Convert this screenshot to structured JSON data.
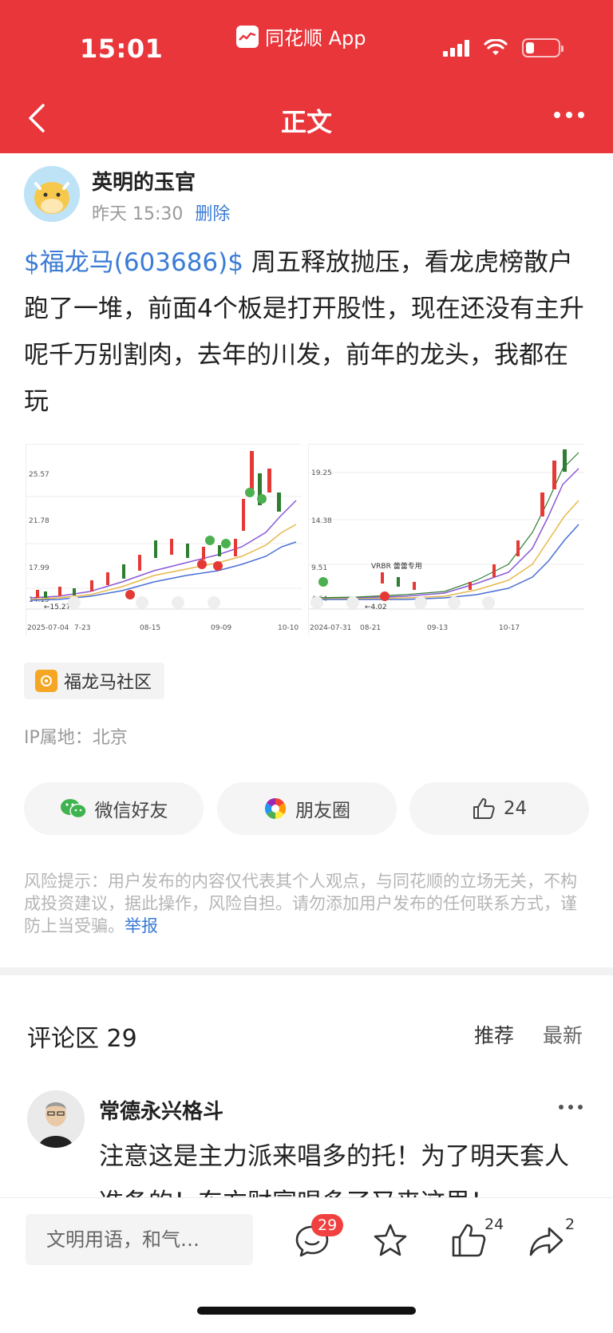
{
  "status_bar": {
    "time": "15:01",
    "app_name": "同花顺 App"
  },
  "nav": {
    "title": "正文"
  },
  "post": {
    "author": "英明的玉官",
    "time": "昨天 15:30",
    "delete_label": "删除",
    "stock_tag": "$福龙马(603686)$",
    "text": " 周五释放抛压，看龙虎榜散户跑了一堆，前面4个板是打开股性，现在还没有主升呢千万别割肉，去年的川发，前年的龙头，我都在玩",
    "community": "福龙马社区",
    "ip": "IP属地：北京"
  },
  "charts": {
    "left": {
      "y_labels": [
        "25.57",
        "21.78",
        "17.99",
        "14.19"
      ],
      "x_labels": [
        "2025-07-04",
        "7-23",
        "08-15",
        "09-09",
        "10-10"
      ],
      "low_marker": "←15.27"
    },
    "right": {
      "y_labels": [
        "19.25",
        "14.38",
        "9.51",
        "4.64"
      ],
      "x_labels": [
        "2024-07-31",
        "08-21",
        "09-13",
        "10-17"
      ],
      "low_marker": "←4.02",
      "annotation": "VRBR 蕾蕾专用"
    }
  },
  "share": {
    "wechat": "微信好友",
    "moments": "朋友圈",
    "likes": "24"
  },
  "risk": {
    "text": "风险提示：用户发布的内容仅代表其个人观点，与同花顺的立场无关，不构成投资建议，据此操作，风险自担。请勿添加用户发布的任何联系方式，谨防上当受骗。",
    "report": "举报"
  },
  "comments": {
    "title": "评论区 29",
    "sort_recommend": "推荐",
    "sort_latest": "最新",
    "first": {
      "user": "常德永兴格斗",
      "text": "注意这是主力派来唱多的托！为了明天套人准备的！东方财富唱多了又来这里！"
    }
  },
  "bottom_bar": {
    "input_placeholder": "文明用语，和气…",
    "comment_count": "29",
    "like_count": "24",
    "share_count": "2"
  },
  "colors": {
    "brand_red": "#e8363b",
    "link_blue": "#3a7bd5"
  }
}
